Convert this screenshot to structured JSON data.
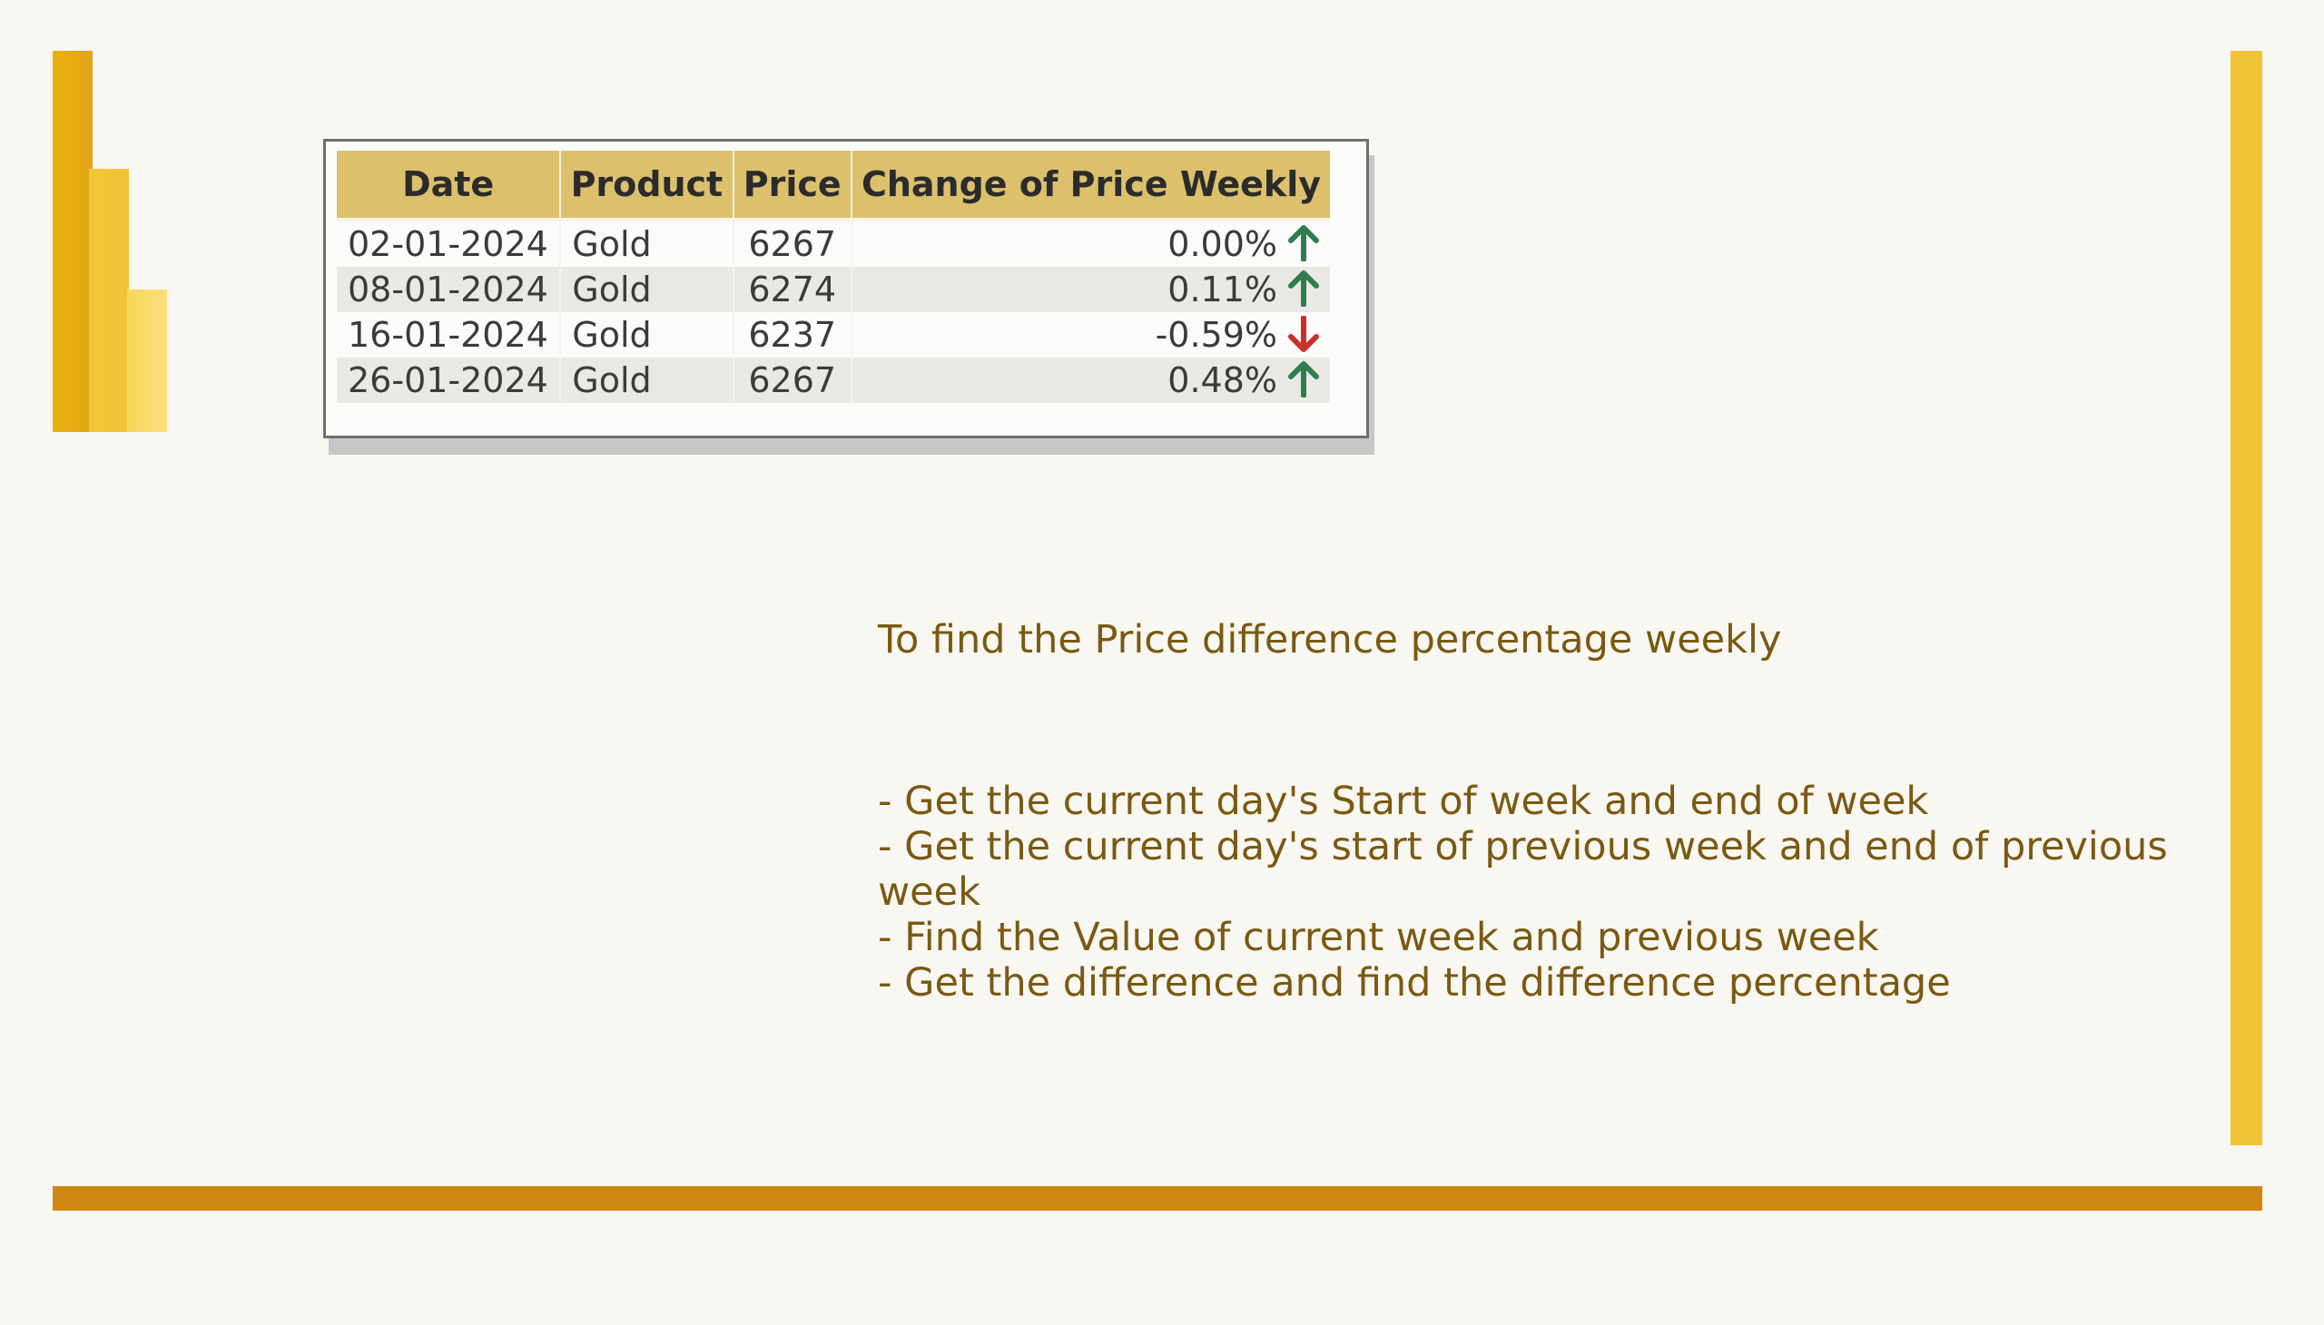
{
  "colors": {
    "logo_bar_1": "#e8b10d",
    "logo_bar_2": "#f2c733",
    "logo_bar_3": "#f7d75a",
    "right_accent": "#f0c335",
    "bottom_accent": "#cf8714",
    "table_header_bg": "#dcc06c",
    "text_color": "#7a5a12",
    "arrow_up": "#2f7d4f",
    "arrow_down": "#c9302c"
  },
  "table": {
    "columns": [
      "Date",
      "Product",
      "Price",
      "Change of Price Weekly"
    ],
    "rows": [
      {
        "date": "02-01-2024",
        "product": "Gold",
        "price": "6267",
        "change": "0.00%",
        "trend": "up"
      },
      {
        "date": "08-01-2024",
        "product": "Gold",
        "price": "6274",
        "change": "0.11%",
        "trend": "up"
      },
      {
        "date": "16-01-2024",
        "product": "Gold",
        "price": "6237",
        "change": "-0.59%",
        "trend": "down"
      },
      {
        "date": "26-01-2024",
        "product": "Gold",
        "price": "6267",
        "change": "0.48%",
        "trend": "up"
      }
    ]
  },
  "notes": {
    "heading": "To find the Price difference percentage weekly",
    "steps": [
      "- Get the current day's Start of week and end of week",
      "- Get the current day's start of previous week and end of previous week",
      "- Find the Value of current week and previous week",
      "- Get the difference and find the difference percentage"
    ]
  },
  "icons": {
    "logo": "power-bi-logo-icon",
    "up": "arrow-up-icon",
    "down": "arrow-down-icon"
  }
}
